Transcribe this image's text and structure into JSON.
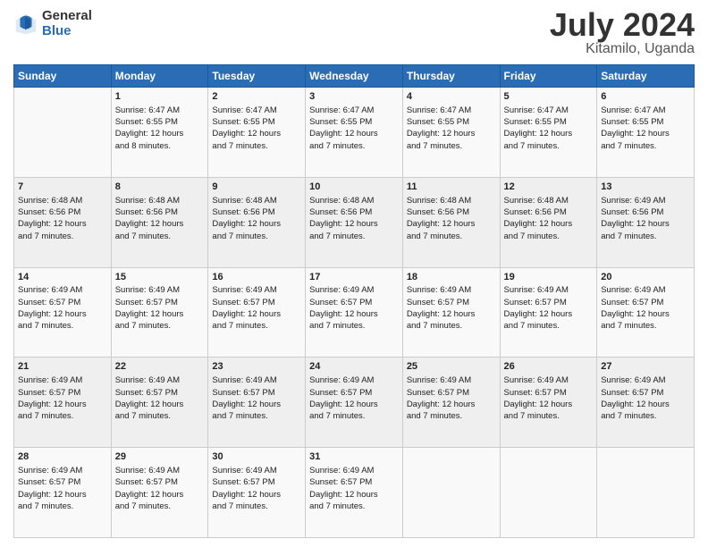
{
  "header": {
    "logo_general": "General",
    "logo_blue": "Blue",
    "title": "July 2024",
    "location": "Kitamilo, Uganda"
  },
  "weekdays": [
    "Sunday",
    "Monday",
    "Tuesday",
    "Wednesday",
    "Thursday",
    "Friday",
    "Saturday"
  ],
  "weeks": [
    [
      {
        "day": "",
        "info": ""
      },
      {
        "day": "1",
        "info": "Sunrise: 6:47 AM\nSunset: 6:55 PM\nDaylight: 12 hours\nand 8 minutes."
      },
      {
        "day": "2",
        "info": "Sunrise: 6:47 AM\nSunset: 6:55 PM\nDaylight: 12 hours\nand 7 minutes."
      },
      {
        "day": "3",
        "info": "Sunrise: 6:47 AM\nSunset: 6:55 PM\nDaylight: 12 hours\nand 7 minutes."
      },
      {
        "day": "4",
        "info": "Sunrise: 6:47 AM\nSunset: 6:55 PM\nDaylight: 12 hours\nand 7 minutes."
      },
      {
        "day": "5",
        "info": "Sunrise: 6:47 AM\nSunset: 6:55 PM\nDaylight: 12 hours\nand 7 minutes."
      },
      {
        "day": "6",
        "info": "Sunrise: 6:47 AM\nSunset: 6:55 PM\nDaylight: 12 hours\nand 7 minutes."
      }
    ],
    [
      {
        "day": "7",
        "info": "Sunrise: 6:48 AM\nSunset: 6:56 PM\nDaylight: 12 hours\nand 7 minutes."
      },
      {
        "day": "8",
        "info": "Sunrise: 6:48 AM\nSunset: 6:56 PM\nDaylight: 12 hours\nand 7 minutes."
      },
      {
        "day": "9",
        "info": "Sunrise: 6:48 AM\nSunset: 6:56 PM\nDaylight: 12 hours\nand 7 minutes."
      },
      {
        "day": "10",
        "info": "Sunrise: 6:48 AM\nSunset: 6:56 PM\nDaylight: 12 hours\nand 7 minutes."
      },
      {
        "day": "11",
        "info": "Sunrise: 6:48 AM\nSunset: 6:56 PM\nDaylight: 12 hours\nand 7 minutes."
      },
      {
        "day": "12",
        "info": "Sunrise: 6:48 AM\nSunset: 6:56 PM\nDaylight: 12 hours\nand 7 minutes."
      },
      {
        "day": "13",
        "info": "Sunrise: 6:49 AM\nSunset: 6:56 PM\nDaylight: 12 hours\nand 7 minutes."
      }
    ],
    [
      {
        "day": "14",
        "info": "Sunrise: 6:49 AM\nSunset: 6:57 PM\nDaylight: 12 hours\nand 7 minutes."
      },
      {
        "day": "15",
        "info": "Sunrise: 6:49 AM\nSunset: 6:57 PM\nDaylight: 12 hours\nand 7 minutes."
      },
      {
        "day": "16",
        "info": "Sunrise: 6:49 AM\nSunset: 6:57 PM\nDaylight: 12 hours\nand 7 minutes."
      },
      {
        "day": "17",
        "info": "Sunrise: 6:49 AM\nSunset: 6:57 PM\nDaylight: 12 hours\nand 7 minutes."
      },
      {
        "day": "18",
        "info": "Sunrise: 6:49 AM\nSunset: 6:57 PM\nDaylight: 12 hours\nand 7 minutes."
      },
      {
        "day": "19",
        "info": "Sunrise: 6:49 AM\nSunset: 6:57 PM\nDaylight: 12 hours\nand 7 minutes."
      },
      {
        "day": "20",
        "info": "Sunrise: 6:49 AM\nSunset: 6:57 PM\nDaylight: 12 hours\nand 7 minutes."
      }
    ],
    [
      {
        "day": "21",
        "info": "Sunrise: 6:49 AM\nSunset: 6:57 PM\nDaylight: 12 hours\nand 7 minutes."
      },
      {
        "day": "22",
        "info": "Sunrise: 6:49 AM\nSunset: 6:57 PM\nDaylight: 12 hours\nand 7 minutes."
      },
      {
        "day": "23",
        "info": "Sunrise: 6:49 AM\nSunset: 6:57 PM\nDaylight: 12 hours\nand 7 minutes."
      },
      {
        "day": "24",
        "info": "Sunrise: 6:49 AM\nSunset: 6:57 PM\nDaylight: 12 hours\nand 7 minutes."
      },
      {
        "day": "25",
        "info": "Sunrise: 6:49 AM\nSunset: 6:57 PM\nDaylight: 12 hours\nand 7 minutes."
      },
      {
        "day": "26",
        "info": "Sunrise: 6:49 AM\nSunset: 6:57 PM\nDaylight: 12 hours\nand 7 minutes."
      },
      {
        "day": "27",
        "info": "Sunrise: 6:49 AM\nSunset: 6:57 PM\nDaylight: 12 hours\nand 7 minutes."
      }
    ],
    [
      {
        "day": "28",
        "info": "Sunrise: 6:49 AM\nSunset: 6:57 PM\nDaylight: 12 hours\nand 7 minutes."
      },
      {
        "day": "29",
        "info": "Sunrise: 6:49 AM\nSunset: 6:57 PM\nDaylight: 12 hours\nand 7 minutes."
      },
      {
        "day": "30",
        "info": "Sunrise: 6:49 AM\nSunset: 6:57 PM\nDaylight: 12 hours\nand 7 minutes."
      },
      {
        "day": "31",
        "info": "Sunrise: 6:49 AM\nSunset: 6:57 PM\nDaylight: 12 hours\nand 7 minutes."
      },
      {
        "day": "",
        "info": ""
      },
      {
        "day": "",
        "info": ""
      },
      {
        "day": "",
        "info": ""
      }
    ]
  ]
}
